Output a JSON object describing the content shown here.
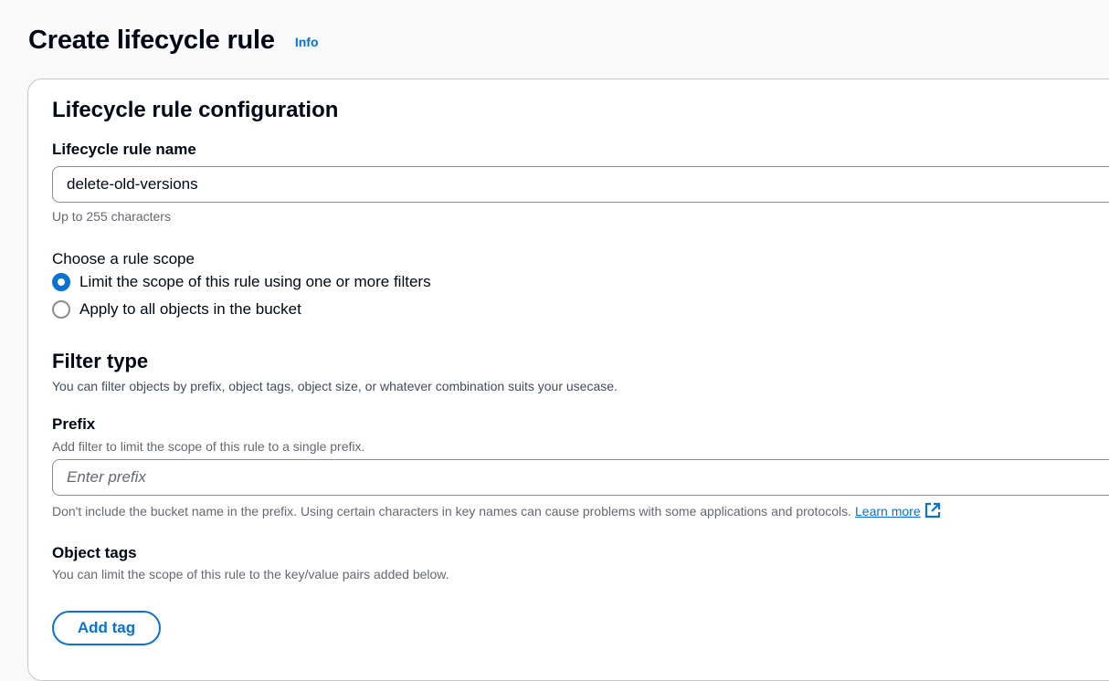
{
  "header": {
    "title": "Create lifecycle rule",
    "info_label": "Info"
  },
  "config": {
    "title": "Lifecycle rule configuration",
    "rule_name": {
      "label": "Lifecycle rule name",
      "value": "delete-old-versions",
      "hint": "Up to 255 characters"
    },
    "scope": {
      "label": "Choose a rule scope",
      "options": [
        {
          "label": "Limit the scope of this rule using one or more filters",
          "checked": true
        },
        {
          "label": "Apply to all objects in the bucket",
          "checked": false
        }
      ]
    }
  },
  "filter_type": {
    "title": "Filter type",
    "description": "You can filter objects by prefix, object tags, object size, or whatever combination suits your usecase.",
    "prefix": {
      "label": "Prefix",
      "description": "Add filter to limit the scope of this rule to a single prefix.",
      "placeholder": "Enter prefix",
      "value": "",
      "hint": "Don't include the bucket name in the prefix. Using certain characters in key names can cause problems with some applications and protocols.",
      "learn_more": "Learn more"
    },
    "object_tags": {
      "label": "Object tags",
      "description": "You can limit the scope of this rule to the key/value pairs added below.",
      "add_tag_label": "Add tag"
    }
  },
  "colors": {
    "accent": "#0972d3",
    "text": "#000716",
    "muted": "#656871",
    "border": "#8c8c94",
    "page_bg": "#f9f9f9"
  },
  "icons": {
    "external_link": "external-link-icon"
  }
}
